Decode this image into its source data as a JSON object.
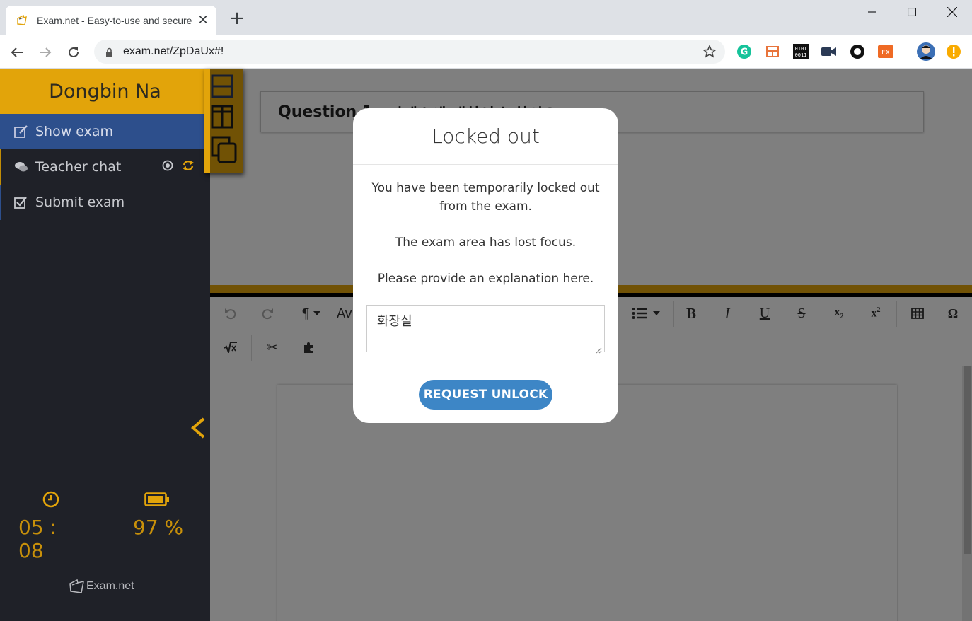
{
  "browser": {
    "tab_title": "Exam.net - Easy-to-use and secure",
    "url": "exam.net/ZpDaUx#!",
    "new_tab_glyph": "+",
    "close_glyph": "✕"
  },
  "sidebar": {
    "student_name": "Dongbin Na",
    "items": [
      {
        "label": "Show exam",
        "icon": "edit-icon"
      },
      {
        "label": "Teacher chat",
        "icon": "chat-icon"
      },
      {
        "label": "Submit exam",
        "icon": "checkbox-icon"
      }
    ],
    "timer": "05 : 08",
    "battery": "97 %",
    "logo_text": "Exam.net"
  },
  "main": {
    "question_label": "Question 1",
    "question_text": "소크라테스에 대하여 논하시오",
    "toolbar_font": "Av"
  },
  "modal": {
    "title": "Locked out",
    "line1": "You have been temporarily locked out from the exam.",
    "line2": "The exam area has lost focus.",
    "line3": "Please provide an explanation here.",
    "textarea_value": "화장실",
    "button_label": "REQUEST UNLOCK"
  },
  "colors": {
    "accent_yellow": "#e2a40a",
    "sidebar_bg": "#1f2128",
    "active_blue": "#2d4f8c",
    "button_blue": "#3d86c6"
  }
}
